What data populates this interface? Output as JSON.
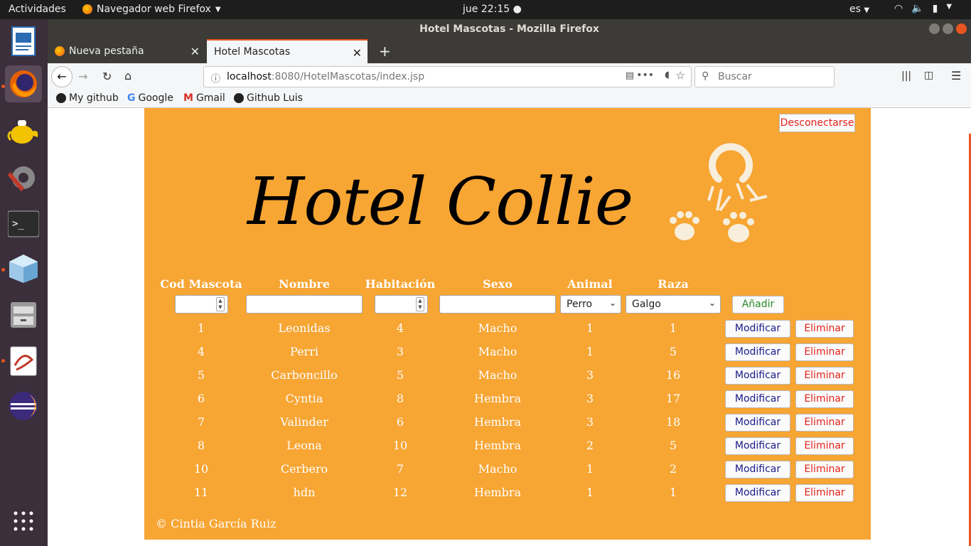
{
  "topbar": {
    "activities": "Actividades",
    "app": "Navegador web Firefox",
    "clock": "jue 22:15 ●",
    "lang": "es"
  },
  "window": {
    "title": "Hotel Mascotas - Mozilla Firefox"
  },
  "tabs": [
    {
      "label": "Nueva pestaña"
    },
    {
      "label": "Hotel Mascotas"
    }
  ],
  "url": {
    "host": "localhost",
    "rest": ":8080/HotelMascotas/index.jsp"
  },
  "search": {
    "placeholder": "Buscar"
  },
  "bookmarks": [
    "My github",
    "Google",
    "Gmail",
    "Github Luis"
  ],
  "page": {
    "logout": "Desconectarse",
    "logo": "Hotel Collie",
    "headers": [
      "Cod Mascota",
      "Nombre",
      "Habitación",
      "Sexo",
      "Animal",
      "Raza"
    ],
    "animal_select": "Perro",
    "raza_select": "Galgo",
    "add": "Añadir",
    "modify": "Modificar",
    "delete": "Eliminar",
    "rows": [
      [
        "1",
        "Leonidas",
        "4",
        "Macho",
        "1",
        "1"
      ],
      [
        "4",
        "Perri",
        "3",
        "Macho",
        "1",
        "5"
      ],
      [
        "5",
        "Carboncillo",
        "5",
        "Macho",
        "3",
        "16"
      ],
      [
        "6",
        "Cyntia",
        "8",
        "Hembra",
        "3",
        "17"
      ],
      [
        "7",
        "Valinder",
        "6",
        "Hembra",
        "3",
        "18"
      ],
      [
        "8",
        "Leona",
        "10",
        "Hembra",
        "2",
        "5"
      ],
      [
        "10",
        "Cerbero",
        "7",
        "Macho",
        "1",
        "2"
      ],
      [
        "11",
        "hdn",
        "12",
        "Hembra",
        "1",
        "1"
      ]
    ],
    "footer": "© Cintia García Ruiz"
  },
  "colors": {
    "panel": "#f7a533",
    "accent": "#e95420"
  }
}
